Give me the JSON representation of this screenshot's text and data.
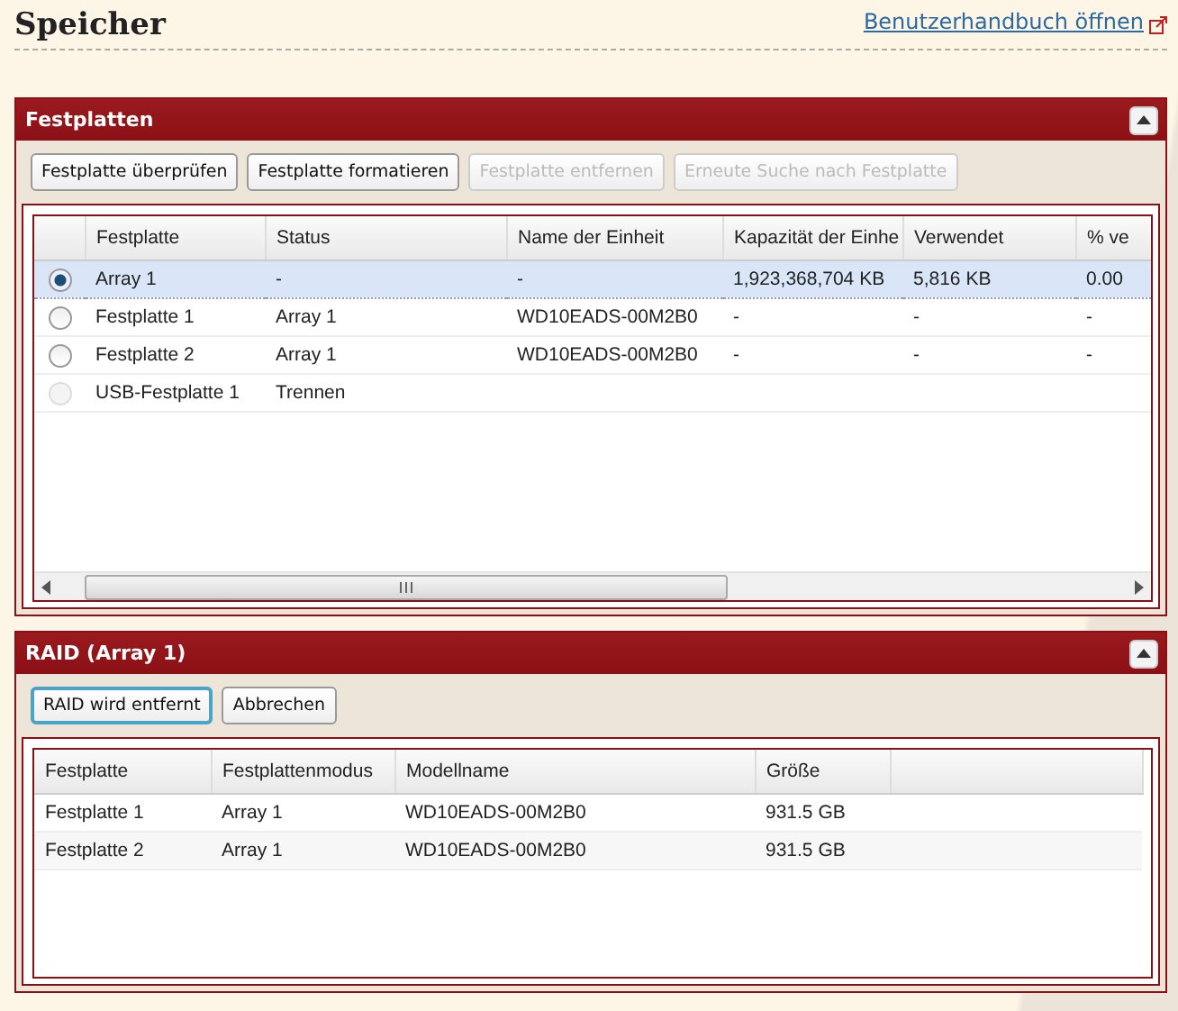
{
  "page": {
    "title": "Speicher",
    "manual_link": "Benutzerhandbuch öffnen"
  },
  "disks_panel": {
    "title": "Festplatten",
    "expanded": true,
    "buttons": [
      {
        "label": "Festplatte überprüfen",
        "disabled": false
      },
      {
        "label": "Festplatte formatieren",
        "disabled": false
      },
      {
        "label": "Festplatte entfernen",
        "disabled": true
      },
      {
        "label": "Erneute Suche nach Festplatte",
        "disabled": true
      }
    ],
    "table": {
      "columns": [
        "Festplatte",
        "Status",
        "Name der Einheit",
        "Kapazität der Einhe",
        "Verwendet",
        "% ve"
      ],
      "rows": [
        {
          "selected": true,
          "disabled": false,
          "cells": [
            "Array 1",
            "-",
            "-",
            "1,923,368,704 KB",
            "5,816 KB",
            "0.00"
          ]
        },
        {
          "selected": false,
          "disabled": false,
          "cells": [
            "Festplatte 1",
            "Array 1",
            "WD10EADS-00M2B0",
            "-",
            "-",
            "-"
          ]
        },
        {
          "selected": false,
          "disabled": false,
          "cells": [
            "Festplatte 2",
            "Array 1",
            "WD10EADS-00M2B0",
            "-",
            "-",
            "-"
          ]
        },
        {
          "selected": false,
          "disabled": true,
          "cells": [
            "USB-Festplatte 1",
            "Trennen",
            "",
            "",
            "",
            ""
          ]
        }
      ]
    }
  },
  "raid_panel": {
    "title": "RAID (Array 1)",
    "expanded": true,
    "buttons": [
      {
        "label": "RAID wird entfernt",
        "focused": true
      },
      {
        "label": "Abbrechen",
        "focused": false
      }
    ],
    "table": {
      "columns": [
        "Festplatte",
        "Festplattenmodus",
        "Modellname",
        "Größe"
      ],
      "rows": [
        {
          "cells": [
            "Festplatte 1",
            "Array 1",
            "WD10EADS-00M2B0",
            "931.5 GB"
          ]
        },
        {
          "cells": [
            "Festplatte 2",
            "Array 1",
            "WD10EADS-00M2B0",
            "931.5 GB"
          ]
        }
      ]
    }
  }
}
